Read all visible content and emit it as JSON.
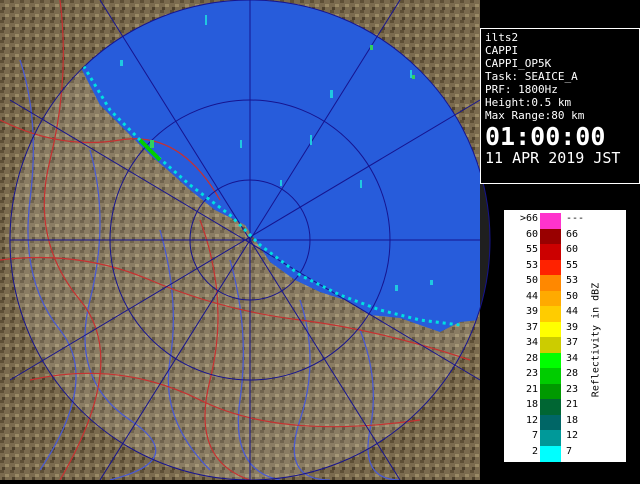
{
  "info": {
    "line1": "ilts2",
    "line2": "CAPPI",
    "line3": "CAPPI_OP5K",
    "line4": "Task: SEAICE_A",
    "line5": "PRF: 1800Hz",
    "line6": "Height:0.5 km",
    "line7": "Max Range:80 km",
    "time": "01:00:00",
    "date": "11 APR 2019 JST"
  },
  "legend": {
    "title": "Reflectivity in dBZ",
    "rows": [
      {
        "lo": ">66",
        "hi": "---",
        "color": "#ff33cc"
      },
      {
        "lo": "60",
        "hi": "66",
        "color": "#990000"
      },
      {
        "lo": "55",
        "hi": "60",
        "color": "#cc0000"
      },
      {
        "lo": "53",
        "hi": "55",
        "color": "#ff2200"
      },
      {
        "lo": "50",
        "hi": "53",
        "color": "#ff8800"
      },
      {
        "lo": "44",
        "hi": "50",
        "color": "#ffaa00"
      },
      {
        "lo": "39",
        "hi": "44",
        "color": "#ffcc00"
      },
      {
        "lo": "37",
        "hi": "39",
        "color": "#ffff00"
      },
      {
        "lo": "34",
        "hi": "37",
        "color": "#cccc00"
      },
      {
        "lo": "28",
        "hi": "34",
        "color": "#00ff00"
      },
      {
        "lo": "23",
        "hi": "28",
        "color": "#00cc00"
      },
      {
        "lo": "21",
        "hi": "23",
        "color": "#009900"
      },
      {
        "lo": "18",
        "hi": "21",
        "color": "#006633"
      },
      {
        "lo": "12",
        "hi": "18",
        "color": "#006666"
      },
      {
        "lo": "7",
        "hi": "12",
        "color": "#009999"
      },
      {
        "lo": "2",
        "hi": "7",
        "color": "#00ffff"
      }
    ]
  },
  "colors": {
    "sea": "#0a46d6",
    "land": "#7a6a4e",
    "range_ring": "#16148f",
    "rivers": "#4a5ad0",
    "boundaries": "#c83030"
  }
}
